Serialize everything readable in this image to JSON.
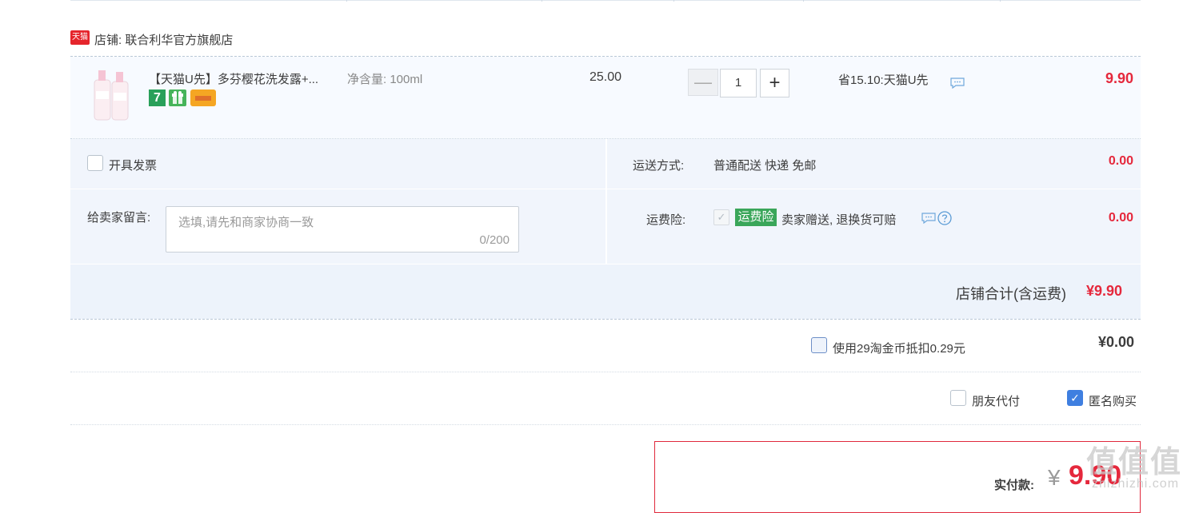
{
  "shop": {
    "badge": "天猫",
    "label": "店铺: 联合利华官方旗舰店"
  },
  "item": {
    "title": "【天猫U先】多芬樱花洗发露+...",
    "spec": "净含量: 100ml",
    "price": "25.00",
    "badge_7": "7",
    "quantity": "1",
    "minus_symbol": "—",
    "plus_symbol": "+",
    "saving": "省15.10:天猫U先",
    "total": "9.90"
  },
  "invoice": {
    "label": "开具发票"
  },
  "shipping": {
    "label": "运送方式:",
    "value": "普通配送 快递 免邮",
    "fee": "0.00"
  },
  "message": {
    "label": "给卖家留言:",
    "placeholder": "选填,请先和商家协商一致",
    "counter": "0/200"
  },
  "insurance": {
    "label": "运费险:",
    "check_symbol": "✓",
    "badge": "运费险",
    "description": "卖家赠送, 退换货可赔",
    "fee": "0.00"
  },
  "subtotal": {
    "label": "店铺合计(含运费)",
    "value": "¥9.90"
  },
  "coins": {
    "label": "使用29淘金币抵扣0.29元",
    "value": "¥0.00"
  },
  "options": {
    "friend_pay": "朋友代付",
    "anonymous": "匿名购买",
    "anonymous_check": "✓"
  },
  "payment": {
    "label": "实付款:",
    "currency": "¥",
    "value": "9.90"
  },
  "watermark": {
    "text": "值值值",
    "url": "zhizhizhi.com"
  },
  "colors": {
    "accent_red": "#e5283c",
    "insurance_green": "#3aa65a",
    "checkbox_blue": "#3f7fe0",
    "panel_bg": "#f1f5fc"
  }
}
